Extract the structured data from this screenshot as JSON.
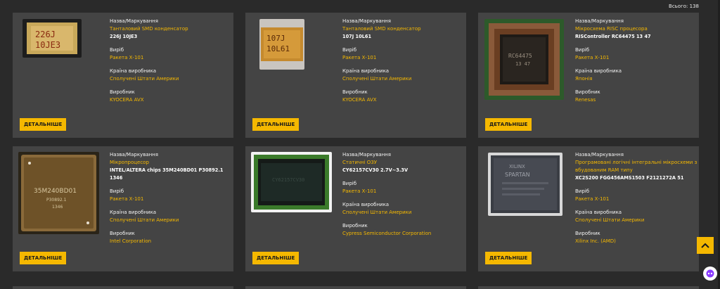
{
  "total": "Всього: 138",
  "colors": {
    "accent": "#f5b800",
    "card": "#444444",
    "page": "#2a2a2a"
  },
  "labels": {
    "name": "Назва/Маркування",
    "product": "Виріб",
    "country": "Країна виробника",
    "maker": "Виробник",
    "details": "ДЕТАЛЬНІШЕ"
  },
  "cards": [
    {
      "type": "Танталовий SMD конденсатор",
      "marking": "226J 10JE3",
      "product": "Ракета Х-101",
      "country": "Сполучені Штати Америки",
      "maker": "KYOCERA AVX",
      "photo_text": [
        "226J",
        "10JE3"
      ]
    },
    {
      "type": "Танталовий SMD конденсатор",
      "marking": "107J 10L61",
      "product": "Ракета Х-101",
      "country": "Сполучені Штати Америки",
      "maker": "KYOCERA AVX",
      "photo_text": [
        "107J",
        "10L61"
      ]
    },
    {
      "type": "Мікросхема RISC процесора",
      "marking": "RISController RC64475 13 47",
      "product": "Ракета Х-101",
      "country": "Японія",
      "maker": "Renesas",
      "photo_text": [
        "RC64475",
        "13 47"
      ]
    },
    {
      "type": "Мікропроцесор",
      "marking": "INTEL/ALTERA chips 35M240BD01 P30892.1 1346",
      "product": "Ракета Х-101",
      "country": "Сполучені Штати Америки",
      "maker": "Intel Corporation",
      "photo_text": [
        "35M240BD01",
        "P30892.1",
        "1346"
      ]
    },
    {
      "type": "Статичні ОЗУ",
      "marking": "CY62157CV30 2.7V~3.3V",
      "product": "Ракета Х-101",
      "country": "Сполучені Штати Америки",
      "maker": "Cypress Semiconductor Corporation",
      "photo_text": [
        "CY62157CV30"
      ]
    },
    {
      "type": "Програмовані логічні інтегральні мікросхеми з вбудованим RAM типу",
      "marking": "XC2S200 FGG456AMS1503 F2121272A 51",
      "product": "Ракета Х-101",
      "country": "Сполучені Штати Америки",
      "maker": "Xilinx Inc. (AMD)",
      "photo_text": [
        "XILINX",
        "SPARTAN"
      ]
    }
  ]
}
